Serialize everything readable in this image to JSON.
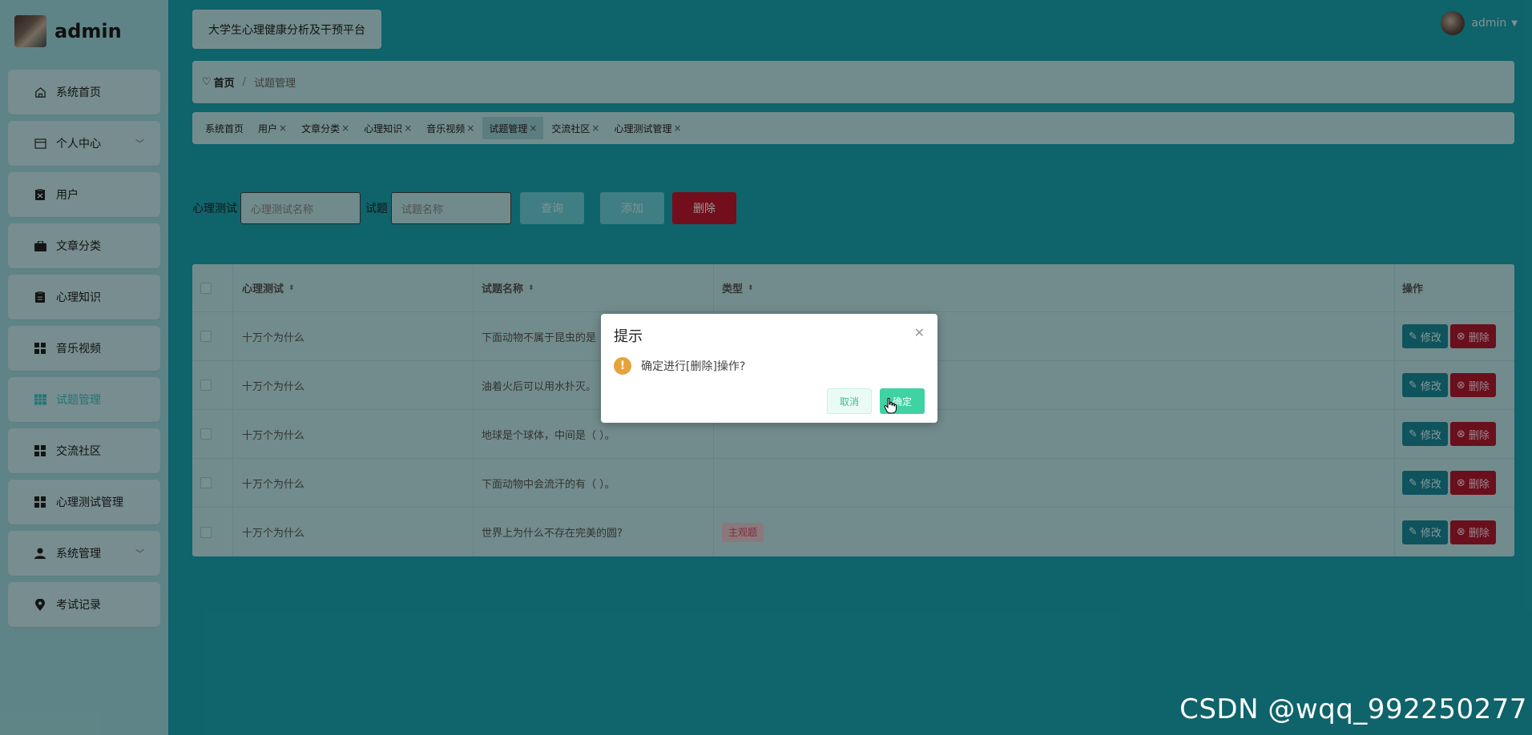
{
  "brand": {
    "name": "admin"
  },
  "header": {
    "platform_title": "大学生心理健康分析及干预平台",
    "user_name": "admin"
  },
  "sidebar": {
    "items": [
      {
        "label": "系统首页",
        "icon": "home-icon"
      },
      {
        "label": "个人中心",
        "icon": "card-icon",
        "has_arrow": true
      },
      {
        "label": "用户",
        "icon": "clipboard-icon"
      },
      {
        "label": "文章分类",
        "icon": "briefcase-icon"
      },
      {
        "label": "心理知识",
        "icon": "notepad-icon"
      },
      {
        "label": "音乐视频",
        "icon": "grid-icon"
      },
      {
        "label": "试题管理",
        "icon": "table-icon",
        "active": true
      },
      {
        "label": "交流社区",
        "icon": "grid-icon"
      },
      {
        "label": "心理测试管理",
        "icon": "grid-icon"
      },
      {
        "label": "系统管理",
        "icon": "user-icon",
        "has_arrow": true
      },
      {
        "label": "考试记录",
        "icon": "pin-icon"
      }
    ]
  },
  "breadcrumb": {
    "home": "首页",
    "separator": "/",
    "current": "试题管理"
  },
  "tabs": [
    {
      "label": "系统首页",
      "closable": false
    },
    {
      "label": "用户",
      "closable": true
    },
    {
      "label": "文章分类",
      "closable": true
    },
    {
      "label": "心理知识",
      "closable": true
    },
    {
      "label": "音乐视频",
      "closable": true
    },
    {
      "label": "试题管理",
      "closable": true,
      "active": true
    },
    {
      "label": "交流社区",
      "closable": true
    },
    {
      "label": "心理测试管理",
      "closable": true
    }
  ],
  "search": {
    "test_label": "心理测试",
    "test_placeholder": "心理测试名称",
    "question_label": "试题",
    "question_placeholder": "试题名称",
    "query_btn": "查询",
    "add_btn": "添加",
    "delete_btn": "删除"
  },
  "table": {
    "columns": [
      "心理测试",
      "试题名称",
      "类型",
      "操作"
    ],
    "rows": [
      {
        "test": "十万个为什么",
        "question": "下面动物不属于昆虫的是",
        "type": ""
      },
      {
        "test": "十万个为什么",
        "question": "油着火后可以用水扑灭。",
        "type": ""
      },
      {
        "test": "十万个为什么",
        "question": "地球是个球体，中间是（ ）。",
        "type": ""
      },
      {
        "test": "十万个为什么",
        "question": "下面动物中会流汗的有（ ）。",
        "type": ""
      },
      {
        "test": "十万个为什么",
        "question": "世界上为什么不存在完美的圆?",
        "type": "主观题"
      }
    ],
    "edit_label": "修改",
    "delete_label": "删除"
  },
  "dialog": {
    "title": "提示",
    "message": "确定进行[删除]操作?",
    "cancel": "取消",
    "confirm": "确定"
  },
  "watermark": "CSDN @wqq_992250277",
  "colors": {
    "teal_bg": "#1aa6b2",
    "danger": "#c0182f",
    "confirm": "#3fd2a3",
    "warning": "#e6a23c"
  }
}
